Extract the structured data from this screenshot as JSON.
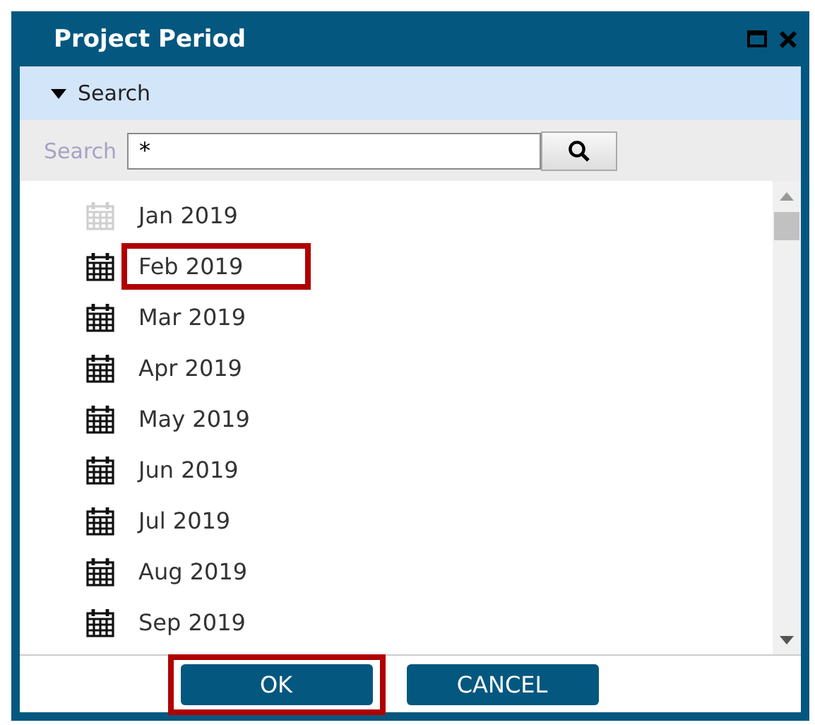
{
  "window": {
    "title": "Project Period"
  },
  "search_panel": {
    "label": "Search",
    "expanded": true
  },
  "search": {
    "label": "Search",
    "value": "*"
  },
  "items": [
    {
      "label": "Jan 2019",
      "disabled": true,
      "highlighted": false
    },
    {
      "label": "Feb 2019",
      "disabled": false,
      "highlighted": true
    },
    {
      "label": "Mar 2019",
      "disabled": false,
      "highlighted": false
    },
    {
      "label": "Apr 2019",
      "disabled": false,
      "highlighted": false
    },
    {
      "label": "May 2019",
      "disabled": false,
      "highlighted": false
    },
    {
      "label": "Jun 2019",
      "disabled": false,
      "highlighted": false
    },
    {
      "label": "Jul 2019",
      "disabled": false,
      "highlighted": false
    },
    {
      "label": "Aug 2019",
      "disabled": false,
      "highlighted": false
    },
    {
      "label": "Sep 2019",
      "disabled": false,
      "highlighted": false
    }
  ],
  "buttons": [
    {
      "label": "OK",
      "highlighted": true
    },
    {
      "label": "CANCEL",
      "highlighted": false
    }
  ]
}
